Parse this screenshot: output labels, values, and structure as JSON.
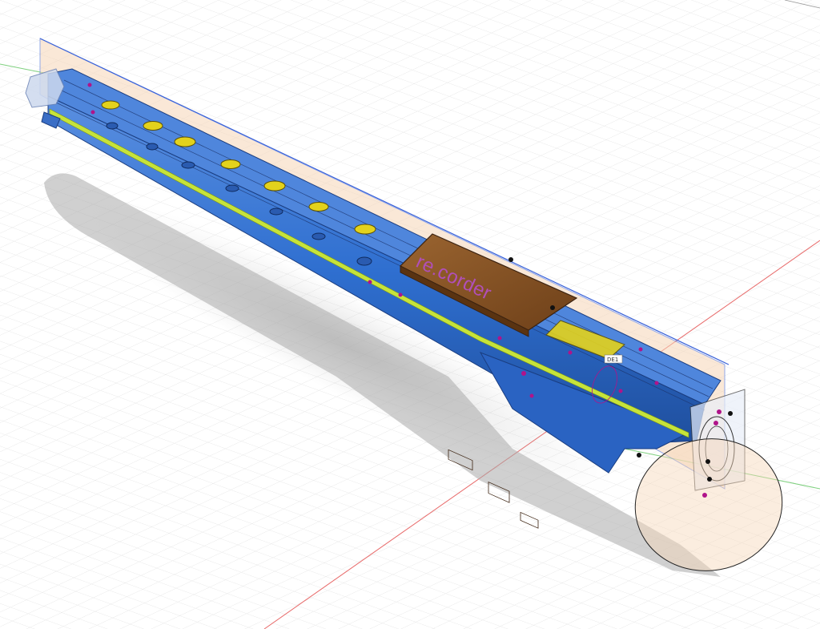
{
  "viewport": {
    "name": "3d-design-viewport",
    "background_color": "#ffffff",
    "grid_color": "#d9d9d9",
    "x_axis_color": "#e05050",
    "y_axis_color": "#6cc46c"
  },
  "model": {
    "body_color": "#2f6fd0",
    "body_dark": "#1f4f9e",
    "highlight_stripe_color": "#c6e33a",
    "hole_color": "#e3d21c",
    "sketch_plane_color": "#f6d6b8",
    "sketch_line_color": "#3a62d8",
    "electronics_board_color": "#8a5426",
    "constraint_point_color": "#b0148a",
    "engraved_label": "re.corder",
    "tag_text": "DE1"
  }
}
